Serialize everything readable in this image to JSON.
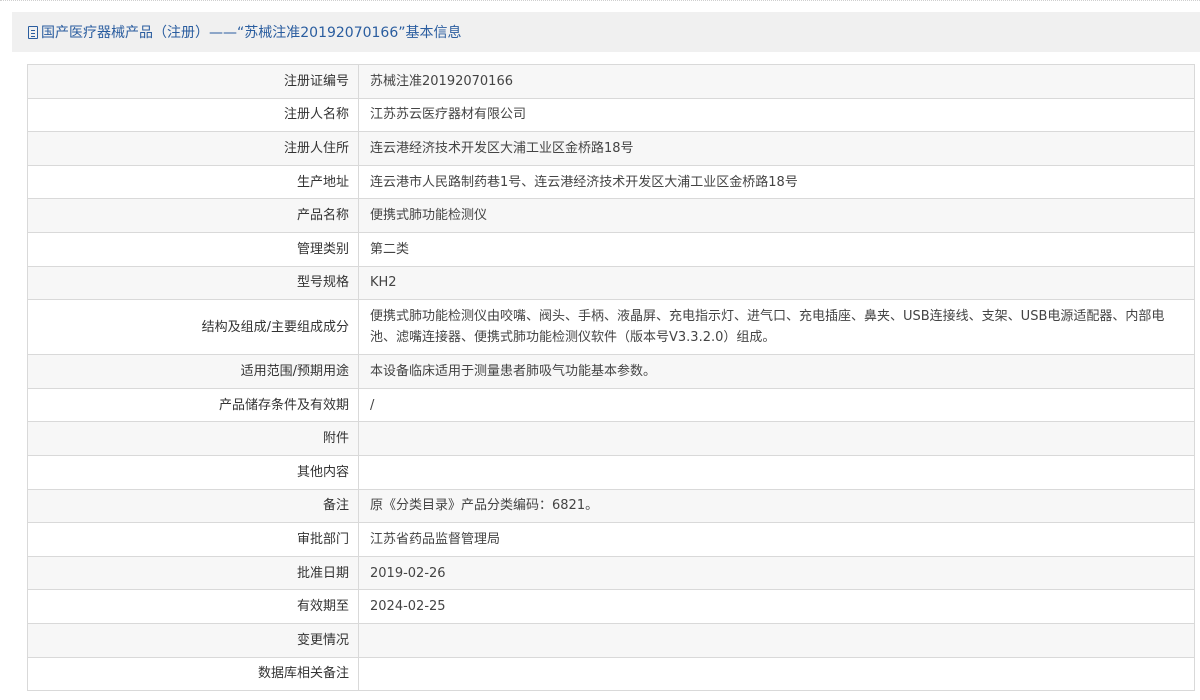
{
  "page": {
    "title": "国产医疗器械产品（注册）——“苏械注准20192070166”基本信息",
    "title_icon": "document-icon",
    "accent_color": "#2a5d9f"
  },
  "fields": [
    {
      "label": "注册证编号",
      "value": "苏械注准20192070166"
    },
    {
      "label": "注册人名称",
      "value": "江苏苏云医疗器材有限公司"
    },
    {
      "label": "注册人住所",
      "value": "连云港经济技术开发区大浦工业区金桥路18号"
    },
    {
      "label": "生产地址",
      "value": "连云港市人民路制药巷1号、连云港经济技术开发区大浦工业区金桥路18号"
    },
    {
      "label": "产品名称",
      "value": "便携式肺功能检测仪"
    },
    {
      "label": "管理类别",
      "value": "第二类"
    },
    {
      "label": "型号规格",
      "value": "KH2"
    },
    {
      "label": "结构及组成/主要组成成分",
      "value": "便携式肺功能检测仪由咬嘴、阀头、手柄、液晶屏、充电指示灯、进气口、充电插座、鼻夹、USB连接线、支架、USB电源适配器、内部电池、滤嘴连接器、便携式肺功能检测仪软件（版本号V3.3.2.0）组成。"
    },
    {
      "label": "适用范围/预期用途",
      "value": "本设备临床适用于测量患者肺吸气功能基本参数。"
    },
    {
      "label": "产品储存条件及有效期",
      "value": "/"
    },
    {
      "label": "附件",
      "value": ""
    },
    {
      "label": "其他内容",
      "value": ""
    },
    {
      "label": "备注",
      "value": "原《分类目录》产品分类编码：6821。"
    },
    {
      "label": "审批部门",
      "value": "江苏省药品监督管理局"
    },
    {
      "label": "批准日期",
      "value": "2019-02-26"
    },
    {
      "label": "有效期至",
      "value": "2024-02-25"
    },
    {
      "label": "变更情况",
      "value": ""
    },
    {
      "label": "数据库相关备注",
      "value": ""
    }
  ]
}
